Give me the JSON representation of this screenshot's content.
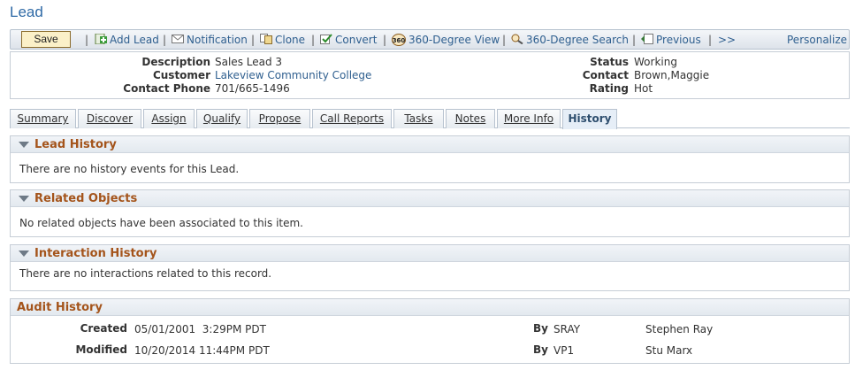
{
  "page": {
    "title": "Lead"
  },
  "toolbar": {
    "save_label": "Save",
    "items": [
      {
        "label": "Add Lead",
        "icon": "add-icon"
      },
      {
        "label": "Notification",
        "icon": "notification-icon"
      },
      {
        "label": "Clone",
        "icon": "clone-icon"
      },
      {
        "label": "Convert",
        "icon": "convert-icon"
      },
      {
        "label": "360-Degree View",
        "icon": "360-icon"
      },
      {
        "label": "360-Degree Search",
        "icon": "search-360-icon"
      },
      {
        "label": "Previous",
        "icon": "previous-icon"
      }
    ],
    "more_label": ">>",
    "personalize_label": "Personalize"
  },
  "summary": {
    "description_label": "Description",
    "description_value": "Sales Lead 3",
    "customer_label": "Customer",
    "customer_value": "Lakeview Community College",
    "contact_phone_label": "Contact Phone",
    "contact_phone_value": "701/665-1496",
    "status_label": "Status",
    "status_value": "Working",
    "contact_label": "Contact",
    "contact_value": "Brown,Maggie",
    "rating_label": "Rating",
    "rating_value": "Hot"
  },
  "tabs": [
    {
      "label": "Summary"
    },
    {
      "label": "Discover"
    },
    {
      "label": "Assign"
    },
    {
      "label": "Qualify"
    },
    {
      "label": "Propose"
    },
    {
      "label": "Call Reports"
    },
    {
      "label": "Tasks"
    },
    {
      "label": "Notes"
    },
    {
      "label": "More Info"
    },
    {
      "label": "History",
      "active": true
    }
  ],
  "lead_history": {
    "title": "Lead History",
    "message": "There are no history events for this Lead."
  },
  "related_objects": {
    "title": "Related Objects",
    "message": "No related objects have been associated to this item."
  },
  "interaction_history": {
    "title": "Interaction History",
    "message": "There are no interactions related to this record."
  },
  "audit_history": {
    "title": "Audit History",
    "created_label": "Created",
    "created_value": "05/01/2001  3:29PM PDT",
    "created_by_label": "By",
    "created_by_id": "SRAY",
    "created_by_name": "Stephen Ray",
    "modified_label": "Modified",
    "modified_value": "10/20/2014 11:44PM PDT",
    "modified_by_label": "By",
    "modified_by_id": "VP1",
    "modified_by_name": "Stu Marx"
  },
  "colors": {
    "link": "#2f5f8f",
    "section_title": "#a4541b",
    "page_title": "#2f6aa6"
  }
}
